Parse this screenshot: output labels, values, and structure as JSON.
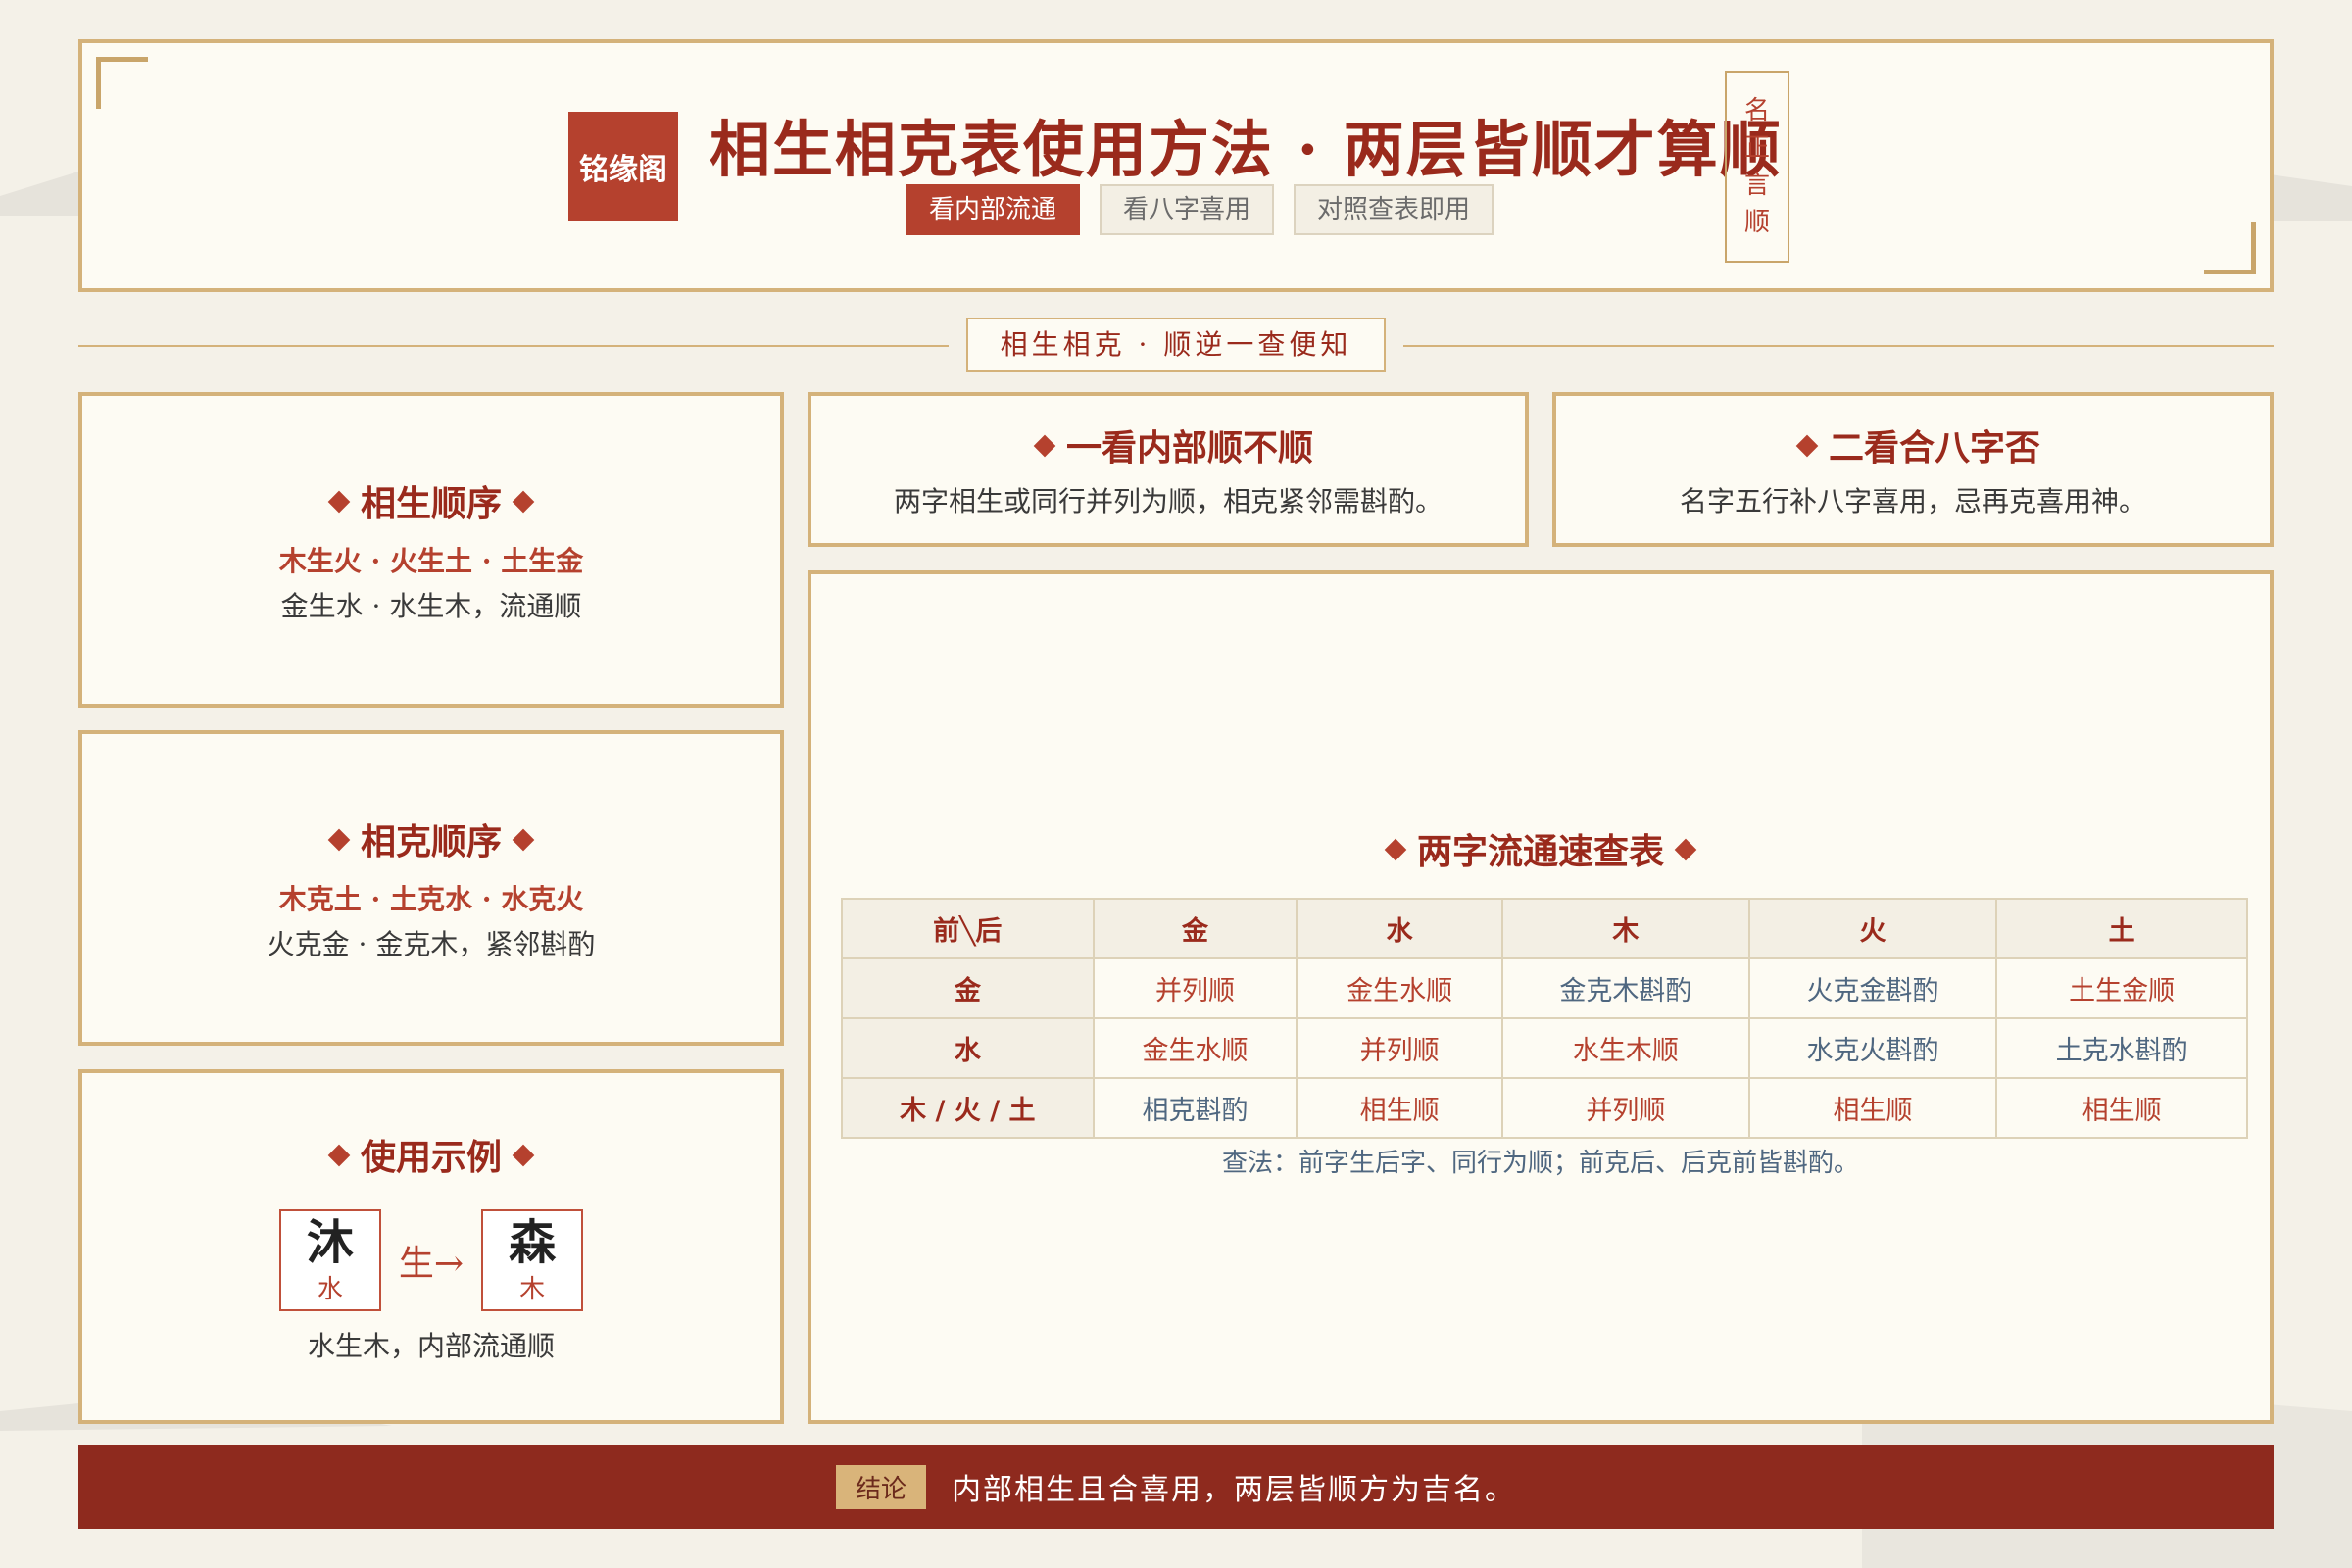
{
  "header": {
    "brand": "铭缘阁",
    "title": "相生相克表使用方法 · 两层皆顺才算顺",
    "tabs": [
      "看内部流通",
      "看八字喜用",
      "对照查表即用"
    ],
    "vertical_seal": [
      "名",
      "正",
      "言",
      "顺"
    ]
  },
  "divider_label": "相生相克 · 顺逆一查便知",
  "sheng": {
    "title": "相生顺序",
    "red": "木生火 · 火生土 · 土生金",
    "dark": "金生水 · 水生木，流通顺"
  },
  "ke": {
    "title": "相克顺序",
    "red": "木克土 · 土克水 · 水克火",
    "dark": "火克金 · 金克木，紧邻斟酌"
  },
  "example": {
    "title": "使用示例",
    "left_char": "沐",
    "left_elem": "水",
    "arrow": "生→",
    "right_char": "森",
    "right_elem": "木",
    "caption": "水生木，内部流通顺"
  },
  "step_one": {
    "title": "一看内部顺不顺",
    "desc": "两字相生或同行并列为顺，相克紧邻需斟酌。"
  },
  "step_two": {
    "title": "二看合八字否",
    "desc": "名字五行补八字喜用，忌再克喜用神。"
  },
  "table": {
    "title": "两字流通速查表",
    "headers": [
      "前╲后",
      "金",
      "水",
      "木",
      "火",
      "土"
    ],
    "rows": [
      {
        "head": "金",
        "cells": [
          "并列顺",
          "金生水顺",
          "金克木斟酌",
          "火克金斟酌",
          "土生金顺"
        ]
      },
      {
        "head": "水",
        "cells": [
          "金生水顺",
          "并列顺",
          "水生木顺",
          "水克火斟酌",
          "土克水斟酌"
        ]
      },
      {
        "head": "木 / 火 / 土",
        "cells": [
          "相克斟酌",
          "相生顺",
          "并列顺",
          "相生顺",
          "相生顺"
        ]
      }
    ],
    "note": "查法：前字生后字、同行为顺；前克后、后克前皆斟酌。"
  },
  "footer": {
    "badge": "结论",
    "text": "内部相生且合喜用，两层皆顺方为吉名。"
  },
  "colors": {
    "accent": "#b5412e",
    "dark_red": "#8e2a1e",
    "gold": "#d4b27a",
    "paper": "#fdfbf3"
  }
}
